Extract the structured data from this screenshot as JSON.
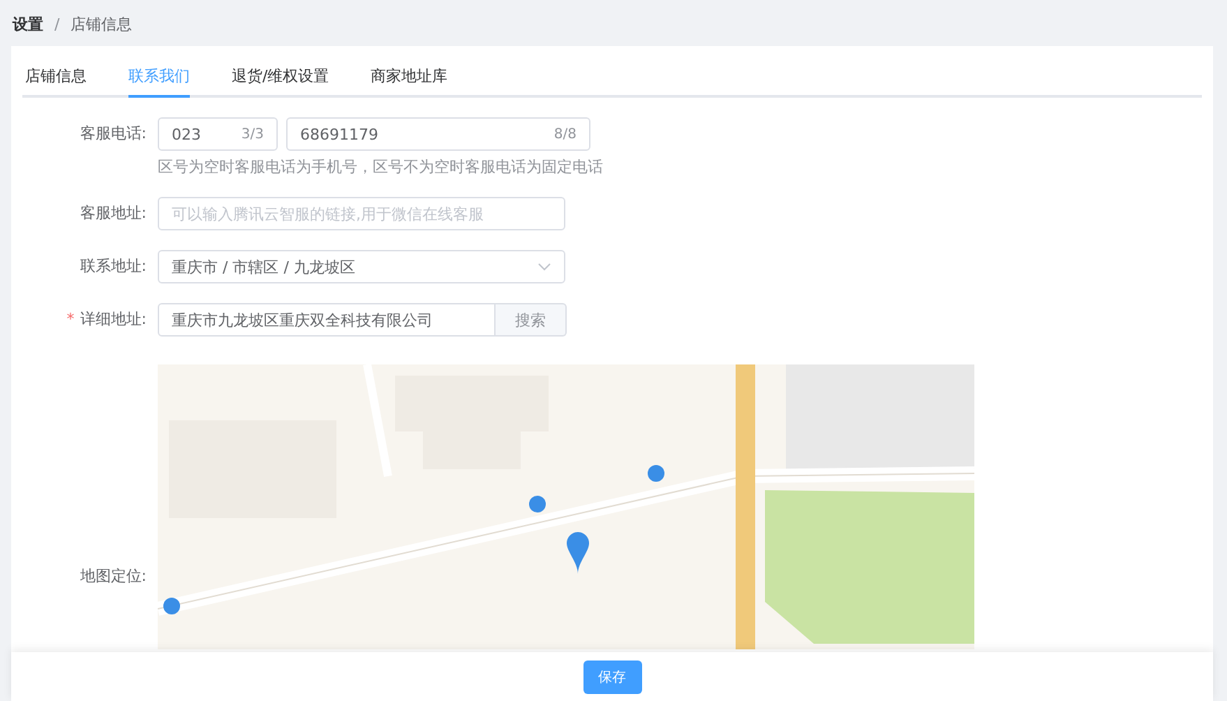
{
  "breadcrumb": [
    {
      "label": "设置",
      "current": false
    },
    {
      "label": "店铺信息",
      "current": true
    }
  ],
  "breadcrumb_separator": "/",
  "tabs": [
    {
      "label": "店铺信息",
      "selected": false
    },
    {
      "label": "联系我们",
      "selected": true
    },
    {
      "label": "退货/维权设置",
      "selected": false
    },
    {
      "label": "商家地址库",
      "selected": false
    }
  ],
  "form": {
    "phone": {
      "label": "客服电话:",
      "area_code": "023",
      "area_count": "3/3",
      "number": "68691179",
      "number_count": "8/8",
      "hint": "区号为空时客服电话为手机号，区号不为空时客服电话为固定电话"
    },
    "service_address": {
      "label": "客服地址:",
      "placeholder": "可以输入腾讯云智服的链接,用于微信在线客服"
    },
    "contact_address": {
      "label": "联系地址:",
      "value": "重庆市 / 市辖区 / 九龙坡区"
    },
    "detail_address": {
      "label": "详细地址:",
      "required_mark": "*",
      "value": "重庆市九龙坡区重庆双全科技有限公司",
      "button": "搜索"
    },
    "map": {
      "label": "地图定位:"
    }
  },
  "footer": {
    "save_button": "保存"
  }
}
